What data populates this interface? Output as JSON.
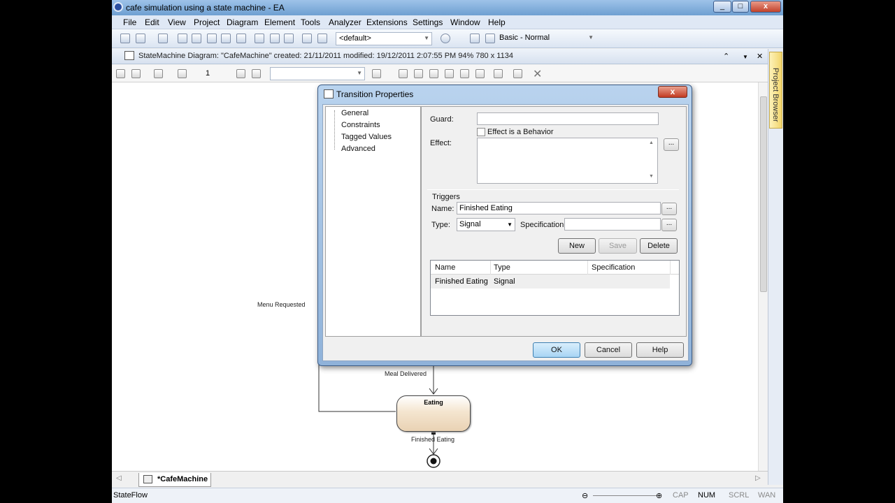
{
  "window": {
    "title": "cafe simulation using a state machine - EA",
    "controls": [
      "_",
      "□",
      "x"
    ]
  },
  "menu": [
    "File",
    "Edit",
    "View",
    "Project",
    "Diagram",
    "Element",
    "Tools",
    "Analyzer",
    "Extensions",
    "Settings",
    "Window",
    "Help"
  ],
  "toolbar": {
    "workspace_combo": "<default>",
    "perspective_combo": "Basic - Normal"
  },
  "caption": {
    "text": "StateMachine Diagram: \"CafeMachine\"   created: 21/11/2011  modified: 19/12/2011 2:07:55 PM   94%   780 x 1134"
  },
  "diagram_toolbar": {
    "line_width": "1"
  },
  "right_pane": {
    "tab_label": "Project Browser"
  },
  "canvas": {
    "labels": {
      "menu_requested": "Menu Requested",
      "meal_delivered": "Meal Delivered",
      "finished_eating": "Finished Eating"
    },
    "states": {
      "eating": "Eating"
    }
  },
  "tabs": {
    "active": "*CafeMachine"
  },
  "statusbar": {
    "left": "StateFlow",
    "indicators": [
      "CAP",
      "NUM",
      "SCRL",
      "WAN"
    ]
  },
  "dialog": {
    "title": "Transition Properties",
    "close_label": "x",
    "tree": [
      "General",
      "Constraints",
      "Tagged Values",
      "Advanced"
    ],
    "guard_label": "Guard:",
    "guard_value": "",
    "effect_checkbox_label": "Effect is a Behavior",
    "effect_label": "Effect:",
    "effect_value": "",
    "triggers_group": "Triggers",
    "name_label": "Name:",
    "name_value": "Finished Eating",
    "type_label": "Type:",
    "type_value": "Signal",
    "specification_label": "Specification",
    "specification_value": "",
    "ellipsis": "...",
    "buttons": {
      "new": "New",
      "save": "Save",
      "delete": "Delete",
      "ok": "OK",
      "cancel": "Cancel",
      "help": "Help"
    },
    "triggers_table": {
      "columns": [
        "Name",
        "Type",
        "Specification"
      ],
      "rows": [
        {
          "name": "Finished Eating",
          "type": "Signal",
          "specification": ""
        }
      ]
    }
  }
}
